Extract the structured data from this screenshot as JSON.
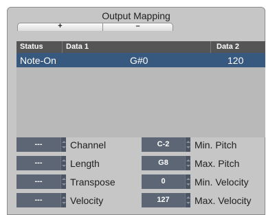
{
  "window": {
    "title": "Output Mapping"
  },
  "toolbar": {
    "add_label": "+",
    "remove_label": "–"
  },
  "table": {
    "headers": {
      "status": "Status",
      "data1": "Data 1",
      "data2": "Data 2"
    },
    "rows": [
      {
        "status": "Note-On",
        "data1": "G#0",
        "data2": "120"
      }
    ]
  },
  "fields": {
    "left": [
      {
        "value": "---",
        "label": "Channel"
      },
      {
        "value": "---",
        "label": "Length"
      },
      {
        "value": "---",
        "label": "Transpose"
      },
      {
        "value": "---",
        "label": "Velocity"
      }
    ],
    "right": [
      {
        "value": "C-2",
        "label": "Min. Pitch"
      },
      {
        "value": "G8",
        "label": "Max. Pitch"
      },
      {
        "value": "0",
        "label": "Min. Velocity"
      },
      {
        "value": "127",
        "label": "Max. Velocity"
      }
    ]
  },
  "colors": {
    "panel": "#c6c6c6",
    "header": "#555555",
    "selected_row": "#37587f",
    "value_field": "#5c6675"
  }
}
